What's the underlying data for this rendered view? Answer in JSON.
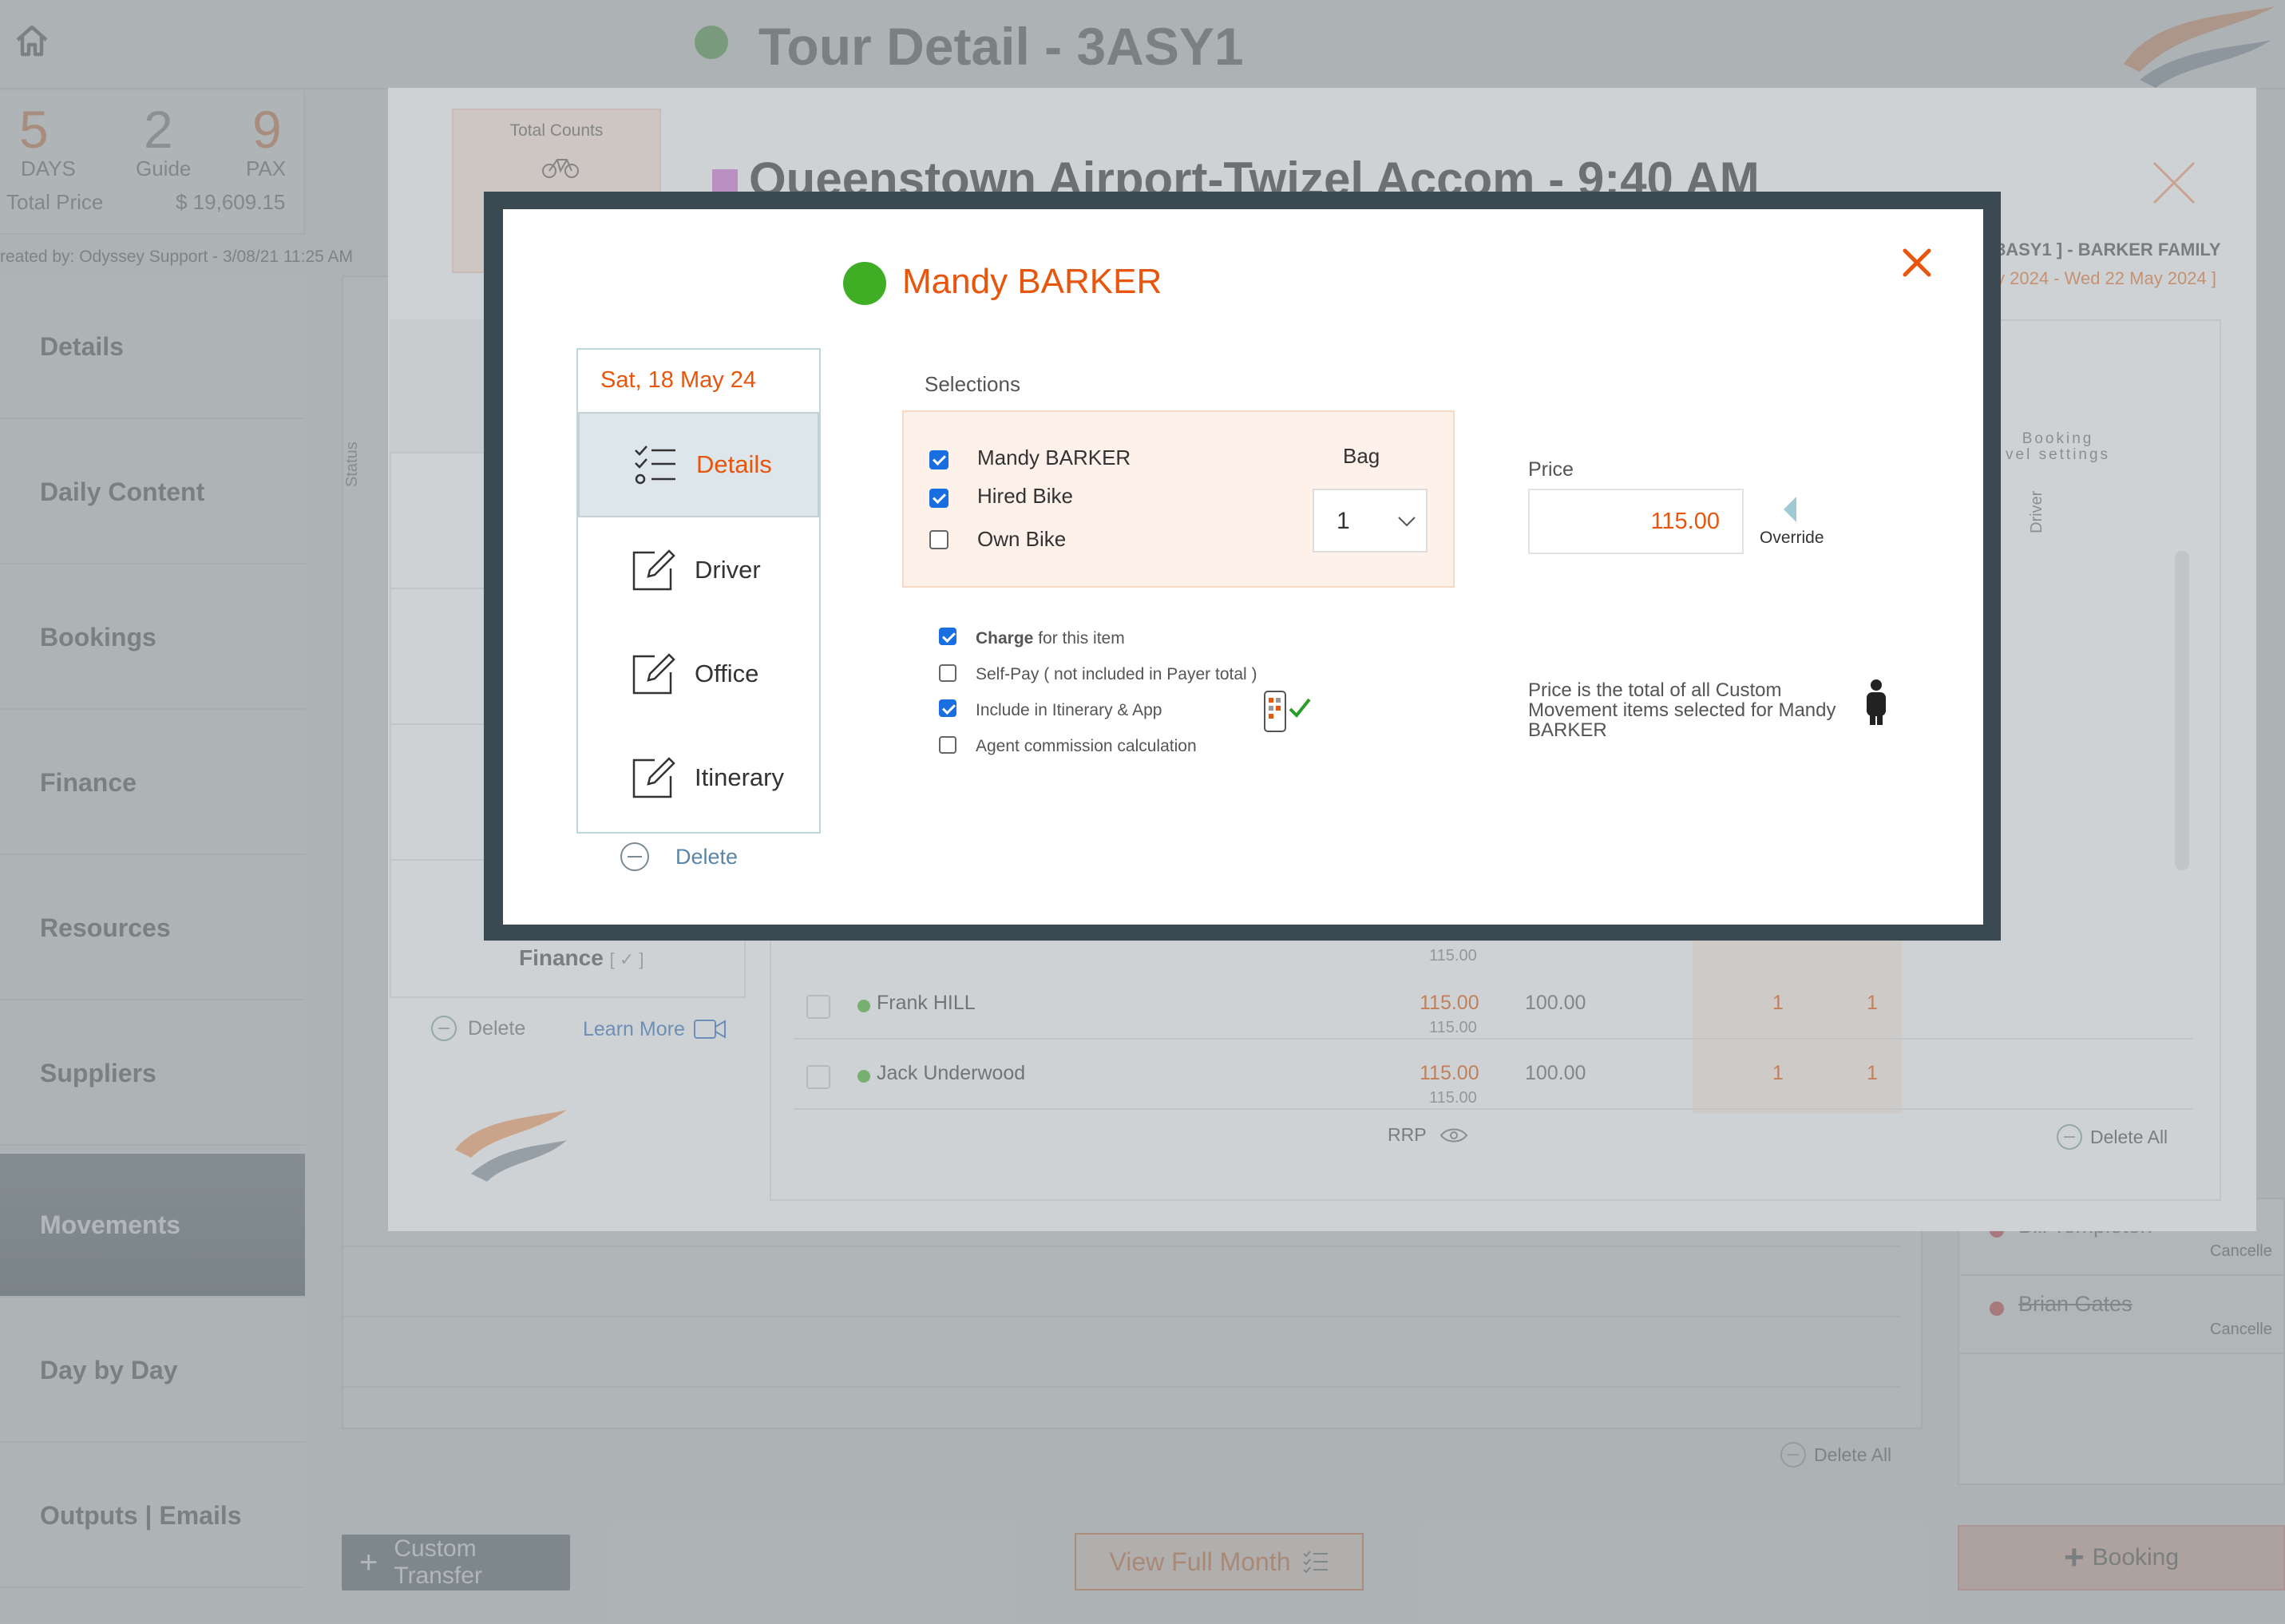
{
  "header": {
    "title": "Tour Detail - 3ASY1"
  },
  "stats": {
    "days_value": "5",
    "days_label": "DAYS",
    "guide_value": "2",
    "guide_label": "Guide",
    "pax_value": "9",
    "pax_label": "PAX",
    "total_price_label": "Total Price",
    "total_price_value": "$ 19,609.15"
  },
  "created_by": "reated by: Odyssey Support - 3/08/21 11:25 AM",
  "sidebar": {
    "items": [
      {
        "label": "Details"
      },
      {
        "label": "Daily Content"
      },
      {
        "label": "Bookings"
      },
      {
        "label": "Finance"
      },
      {
        "label": "Resources"
      },
      {
        "label": "Suppliers"
      },
      {
        "label": "Movements",
        "active": true
      },
      {
        "label": "Day by Day"
      },
      {
        "label": "Outputs | Emails"
      }
    ]
  },
  "background": {
    "status_label": "Status",
    "delete_all": "Delete All",
    "custom_transfer": "Custom Transfer",
    "view_full_month": "View Full Month",
    "booking": "Booking",
    "cancelled": [
      {
        "name": "Bill Templeton",
        "status": "Cancelle"
      },
      {
        "name": "Brian Gates",
        "status": "Cancelle"
      }
    ]
  },
  "movement_modal": {
    "total_counts": "Total Counts",
    "title": "Queenstown Airport-Twizel Accom - 9:40 AM",
    "tour_ref": "3ASY1 ] - BARKER FAMILY",
    "dates": "y 2024 - Wed 22 May 2024 ]",
    "finance_label": "Finance",
    "finance_mark": "[ ✓ ]",
    "delete": "Delete",
    "learn_more": "Learn More",
    "booking_settings_line1": "Booking",
    "booking_settings_line2": "vel settings",
    "driver_col": "Driver",
    "prev_row_sub": "115.00",
    "rows": [
      {
        "name": "Frank HILL",
        "price": "115.00",
        "price_sub": "115.00",
        "cost": "100.00",
        "qty1": "1",
        "qty2": "1"
      },
      {
        "name": "Jack Underwood",
        "price": "115.00",
        "price_sub": "115.00",
        "cost": "100.00",
        "qty1": "1",
        "qty2": "1"
      }
    ],
    "rrp": "RRP",
    "delete_all": "Delete All"
  },
  "modal": {
    "person_name": "Mandy BARKER",
    "date": "Sat, 18 May 24",
    "nav": [
      {
        "label": "Details",
        "active": true
      },
      {
        "label": "Driver"
      },
      {
        "label": "Office"
      },
      {
        "label": "Itinerary"
      }
    ],
    "delete": "Delete",
    "selections_label": "Selections",
    "selections": [
      {
        "label": "Mandy BARKER",
        "checked": true
      },
      {
        "label": "Hired Bike",
        "checked": true
      },
      {
        "label": "Own  Bike",
        "checked": false
      }
    ],
    "bag_label": "Bag",
    "bag_value": "1",
    "options": {
      "charge_bold": "Charge",
      "charge_rest": " for this item",
      "charge_checked": true,
      "self_pay": "Self-Pay ( not included in Payer total )",
      "self_pay_checked": false,
      "include": "Include in Itinerary & App",
      "include_checked": true,
      "agent": "Agent commission calculation",
      "agent_checked": false
    },
    "price_label": "Price",
    "price_value": "115.00",
    "override_label": "Override",
    "price_note": "Price is the total of all Custom Movement items selected for Mandy BARKER",
    "colors": {
      "accent": "#e8550c",
      "status_green": "#3fae24",
      "checkbox_blue": "#1a6fe0",
      "frame": "#3b4a52"
    }
  }
}
